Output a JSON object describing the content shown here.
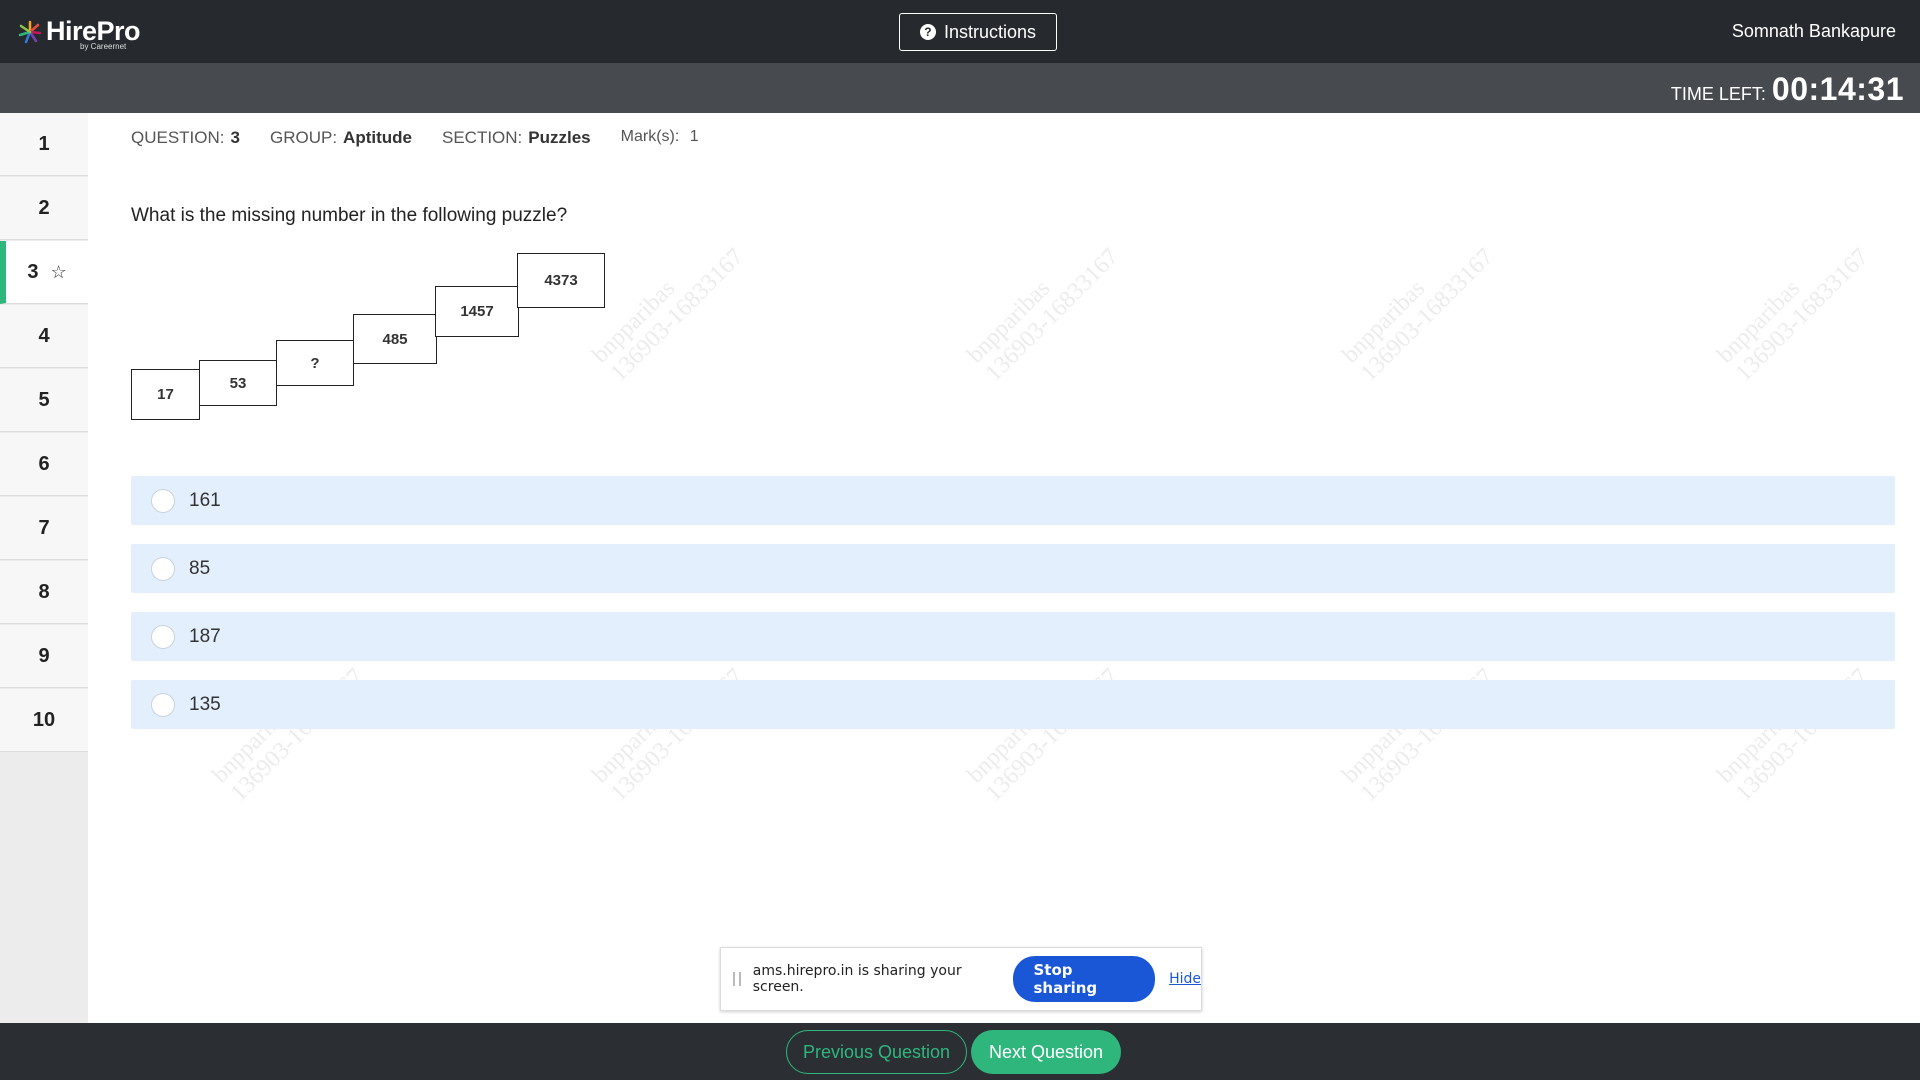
{
  "header": {
    "logo_text": "HirePro",
    "logo_subtext": "by Careernet",
    "instructions_label": "Instructions",
    "user_name": "Somnath Bankapure"
  },
  "timer": {
    "label": "TIME LEFT:",
    "value": "00:14:31"
  },
  "nav": {
    "items": [
      "1",
      "2",
      "3",
      "4",
      "5",
      "6",
      "7",
      "8",
      "9",
      "10"
    ],
    "active": "3"
  },
  "meta": {
    "question_label": "QUESTION:",
    "question_value": "3",
    "group_label": "GROUP:",
    "group_value": "Aptitude",
    "section_label": "SECTION:",
    "section_value": "Puzzles",
    "marks_label": "Mark(s):",
    "marks_value": "1"
  },
  "question": {
    "text": "What is the missing number in the following puzzle?",
    "puzzle": [
      "17",
      "53",
      "?",
      "485",
      "1457",
      "4373"
    ]
  },
  "options": [
    "161",
    "85",
    "187",
    "135"
  ],
  "watermark": {
    "line1": "bnpparibas",
    "line2": "136903-16833167"
  },
  "share_banner": {
    "text": "ams.hirepro.in is sharing your screen.",
    "stop_label": "Stop sharing",
    "hide_label": "Hide"
  },
  "footer": {
    "prev_label": "Previous Question",
    "next_label": "Next Question"
  },
  "colors": {
    "accent": "#2eb67d",
    "topbar": "#262a2e",
    "option_bg": "#e3effc",
    "share_button": "#1a57d6"
  }
}
